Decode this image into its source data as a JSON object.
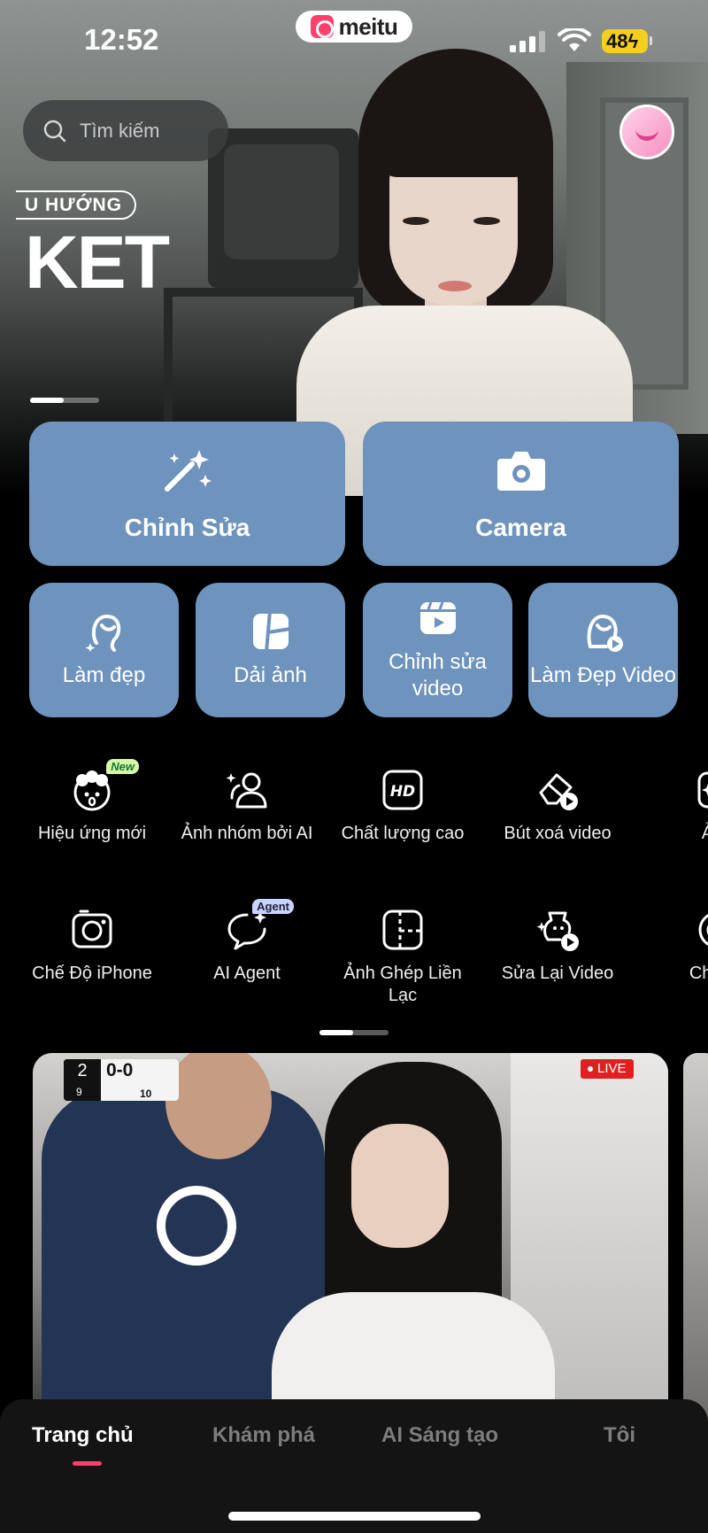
{
  "status_bar": {
    "time": "12:52",
    "battery": "48"
  },
  "brand": {
    "name": "meitu"
  },
  "search": {
    "placeholder": "Tìm kiếm"
  },
  "banner": {
    "tag": "U HƯỚNG",
    "headline": "KET"
  },
  "main_actions": [
    {
      "label": "Chỉnh Sửa",
      "icon": "magic-wand-icon"
    },
    {
      "label": "Camera",
      "icon": "camera-icon"
    }
  ],
  "quick_actions": [
    {
      "label": "Làm đẹp",
      "icon": "beauty-face-icon"
    },
    {
      "label": "Dải ảnh",
      "icon": "collage-icon"
    },
    {
      "label": "Chỉnh sửa video",
      "icon": "video-edit-icon"
    },
    {
      "label": "Làm Đẹp Video",
      "icon": "video-beauty-icon"
    }
  ],
  "tools_row1": [
    {
      "label": "Hiệu ứng mới",
      "icon": "new-effects-icon",
      "badge": "New"
    },
    {
      "label": "Ảnh nhóm bởi AI",
      "icon": "group-photo-icon"
    },
    {
      "label": "Chất lượng cao",
      "icon": "hd-icon"
    },
    {
      "label": "Bút xoá video",
      "icon": "video-eraser-icon"
    },
    {
      "label": "Ản",
      "icon": "partial-tool-icon"
    }
  ],
  "tools_row2": [
    {
      "label": "Chế Độ iPhone",
      "icon": "iphone-camera-icon"
    },
    {
      "label": "AI Agent",
      "icon": "ai-agent-icon",
      "badge": "Agent"
    },
    {
      "label": "Ảnh Ghép Liền Lạc",
      "icon": "seamless-collage-icon"
    },
    {
      "label": "Sửa Lại Video",
      "icon": "video-retouch-icon"
    },
    {
      "label": "Chỉnh",
      "icon": "partial-tool-icon"
    }
  ],
  "feed": {
    "score": {
      "inning": "2",
      "outs": "9",
      "runs": "0-0",
      "count": "10"
    },
    "live_label": "LIVE"
  },
  "tabs": [
    {
      "label": "Trang chủ",
      "active": true
    },
    {
      "label": "Khám phá",
      "active": false
    },
    {
      "label": "AI Sáng tạo",
      "active": false
    },
    {
      "label": "Tôi",
      "active": false
    }
  ],
  "colors": {
    "tile": "#6e93bd",
    "accent": "#ff3f6c",
    "battery": "#f5cf1d"
  }
}
